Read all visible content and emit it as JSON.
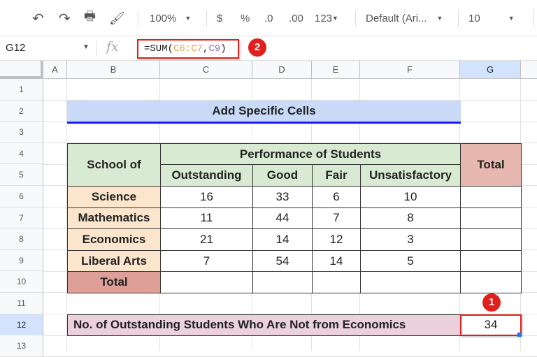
{
  "toolbar": {
    "zoom": "100%",
    "currency": "$",
    "percent": "%",
    "dec_decrease": ".0",
    "dec_increase": ".00",
    "more_formats": "123",
    "font": "Default (Ari...",
    "font_size": "10"
  },
  "formula_bar": {
    "name_box": "G12",
    "fx": "fx",
    "formula_prefix": "=SUM(",
    "ref1": "C6:C7",
    "comma": ",",
    "ref2": "C9",
    "formula_suffix": ")"
  },
  "columns": [
    "A",
    "B",
    "C",
    "D",
    "E",
    "F",
    "G"
  ],
  "rows": [
    "1",
    "2",
    "3",
    "4",
    "5",
    "6",
    "7",
    "8",
    "9",
    "10",
    "11",
    "12",
    "13"
  ],
  "sheet": {
    "title": "Add Specific Cells",
    "header_school": "School of",
    "header_performance": "Performance of Students",
    "header_total": "Total",
    "subheaders": [
      "Outstanding",
      "Good",
      "Fair",
      "Unsatisfactory"
    ],
    "data": [
      {
        "school": "Science",
        "values": [
          "16",
          "33",
          "6",
          "10"
        ]
      },
      {
        "school": "Mathematics",
        "values": [
          "11",
          "44",
          "7",
          "8"
        ]
      },
      {
        "school": "Economics",
        "values": [
          "21",
          "14",
          "12",
          "3"
        ]
      },
      {
        "school": "Liberal Arts",
        "values": [
          "7",
          "54",
          "14",
          "5"
        ]
      }
    ],
    "total_label": "Total",
    "result_label": "No. of Outstanding Students Who Are Not from Economics",
    "result_value": "34"
  },
  "annotations": {
    "step1": "1",
    "step2": "2"
  },
  "colors": {
    "highlight": "#e0201c",
    "title_bg": "#c9daf8",
    "green": "#d9ead3",
    "orange": "#fce5cd",
    "pink": "#e6b8af",
    "purple": "#ead1dc"
  }
}
